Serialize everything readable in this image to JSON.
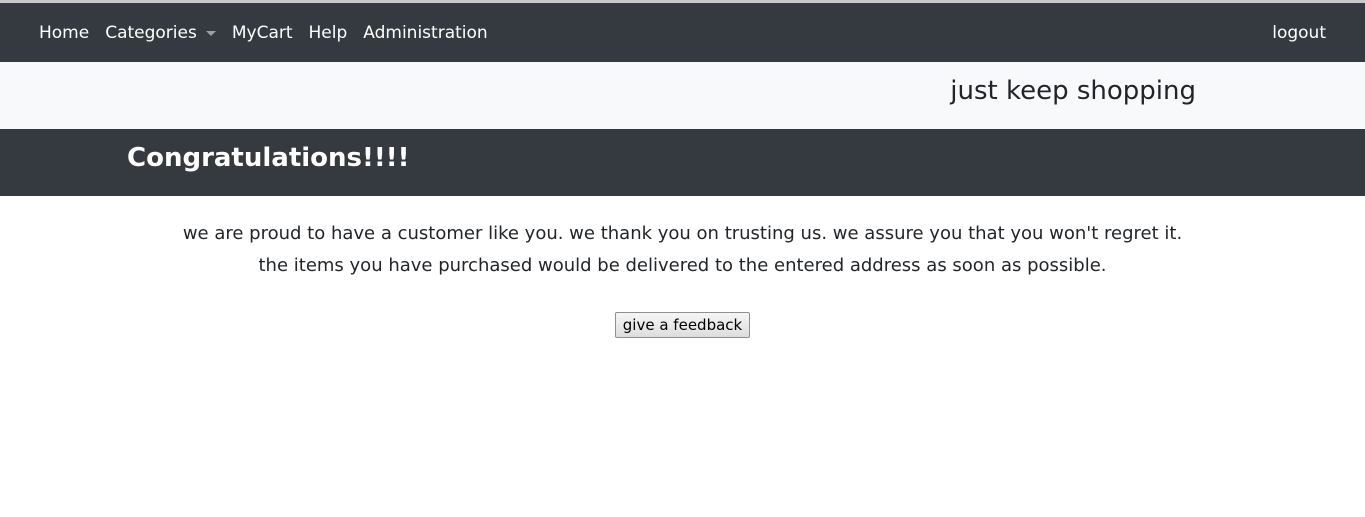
{
  "navbar": {
    "items": [
      {
        "label": "Home"
      },
      {
        "label": "Categories"
      },
      {
        "label": "MyCart"
      },
      {
        "label": "Help"
      },
      {
        "label": "Administration"
      }
    ],
    "logout_label": "logout"
  },
  "tagline": "just keep shopping",
  "congrats_heading": "Congratulations!!!!",
  "message": {
    "line1": "we are proud to have a customer like you. we thank you on trusting us. we assure you that you won't regret it.",
    "line2": "the items you have purchased would be delivered to the entered address as soon as possible."
  },
  "feedback_button_label": "give a feedback",
  "colors": {
    "navbar_bg": "#343a40",
    "tagline_bg": "#f8f9fa",
    "text_dark": "#212529"
  }
}
